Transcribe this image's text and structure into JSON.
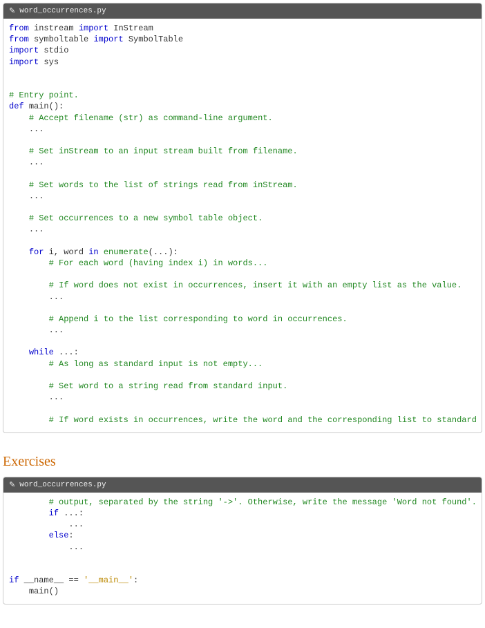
{
  "block1": {
    "filename": "word_occurrences.py",
    "l1_from": "from",
    "l1_mod": "instream",
    "l1_import": "import",
    "l1_name": "InStream",
    "l2_from": "from",
    "l2_mod": "symboltable",
    "l2_import": "import",
    "l2_name": "SymbolTable",
    "l3_import": "import",
    "l3_mod": "stdio",
    "l4_import": "import",
    "l4_mod": "sys",
    "c_entry": "# Entry point.",
    "def": "def",
    "main_name": "main():",
    "c_accept": "# Accept filename (str) as command-line argument.",
    "c_instream": "# Set inStream to an input stream built from filename.",
    "c_words": "# Set words to the list of strings read from inStream.",
    "c_occ": "# Set occurrences to a new symbol table object.",
    "for": "for",
    "for_mid": " i, word ",
    "in": "in",
    "enumerate": "enumerate",
    "for_tail": "(...):",
    "c_foreach": "# For each word (having index i) in words...",
    "c_ifnot": "# If word does not exist in occurrences, insert it with an empty list as the value.",
    "c_append": "# Append i to the list corresponding to word in occurrences.",
    "while": "while",
    "while_tail": " ...:",
    "c_aslong": "# As long as standard input is not empty...",
    "c_setword": "# Set word to a string read from standard input.",
    "c_ifexists": "# If word exists in occurrences, write the word and the corresponding list to standard",
    "dots": "..."
  },
  "heading": "Exercises",
  "block2": {
    "filename": "word_occurrences.py",
    "c_output": "# output, separated by the string '->'. Otherwise, write the message 'Word not found'.",
    "if": "if",
    "if_tail": " ...:",
    "else": "else",
    "else_tail": ":",
    "dots": "...",
    "if2": "if",
    "name_var": "__name__",
    "eqeq": " == ",
    "main_str": "'__main__'",
    "colon": ":",
    "main_call": "main()"
  }
}
